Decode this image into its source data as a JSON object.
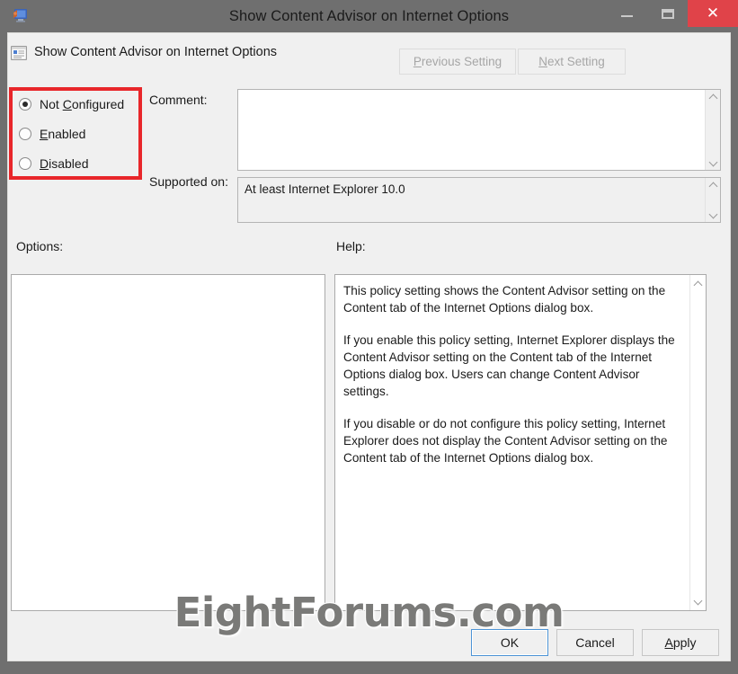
{
  "window": {
    "title": "Show Content Advisor on Internet Options",
    "icon": "gpedit-policy-icon",
    "controls": {
      "minimize": "minimize-icon",
      "maximize": "maximize-icon",
      "close": "✕"
    }
  },
  "header": {
    "icon": "policy-setting-icon",
    "title": "Show Content Advisor on Internet Options",
    "previous_setting": "Previous Setting",
    "next_setting": "Next Setting",
    "previous_accel": "P",
    "next_accel": "N"
  },
  "state": {
    "options": [
      {
        "label": "Not Configured",
        "accel": "C",
        "selected": true
      },
      {
        "label": "Enabled",
        "accel": "E",
        "selected": false
      },
      {
        "label": "Disabled",
        "accel": "D",
        "selected": false
      }
    ],
    "highlight_color": "#e8262a"
  },
  "fields": {
    "comment_label": "Comment:",
    "comment_value": "",
    "supported_label": "Supported on:",
    "supported_value": "At least Internet Explorer 10.0"
  },
  "sections": {
    "options_label": "Options:",
    "help_label": "Help:",
    "options_content": "",
    "help_paragraphs": [
      "This policy setting shows the Content Advisor setting on the Content tab of the Internet Options dialog box.",
      "If you enable this policy setting, Internet Explorer displays the Content Advisor setting on the Content tab of the Internet Options dialog box. Users can change Content Advisor settings.",
      "If you disable or do not configure this policy setting, Internet Explorer does not display the Content Advisor setting on the Content tab of the Internet Options dialog box."
    ]
  },
  "footer": {
    "ok": "OK",
    "cancel": "Cancel",
    "apply": "Apply",
    "apply_accel": "A"
  },
  "watermark": "EightForums.com"
}
